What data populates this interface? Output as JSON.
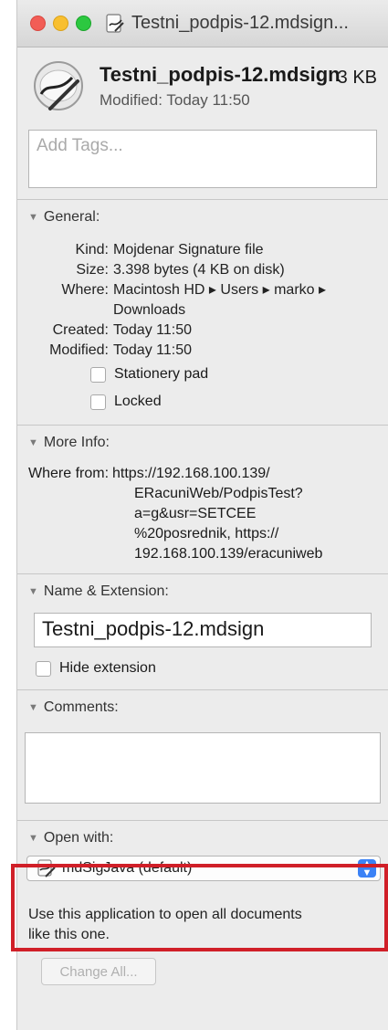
{
  "window": {
    "title": "Testni_podpis-12.mdsign..."
  },
  "header": {
    "filename": "Testni_podpis-12.mdsign",
    "size": "3 KB",
    "modified": "Modified: Today 11:50"
  },
  "tags": {
    "placeholder": "Add Tags..."
  },
  "general": {
    "heading": "General:",
    "rows": [
      {
        "key": "Kind:",
        "value": "Mojdenar Signature file"
      },
      {
        "key": "Size:",
        "value": "3.398 bytes (4 KB on disk)"
      },
      {
        "key": "Where:",
        "value": "Macintosh HD ▸ Users ▸ marko ▸",
        "value2": "Downloads"
      },
      {
        "key": "Created:",
        "value": "Today 11:50"
      },
      {
        "key": "Modified:",
        "value": "Today 11:50"
      }
    ],
    "stationery_label": "Stationery pad",
    "locked_label": "Locked"
  },
  "more_info": {
    "heading": "More Info:",
    "where_from_key": "Where from:",
    "where_from_lines": [
      "https://192.168.100.139/",
      "ERacuniWeb/PodpisTest?",
      "a=g&usr=SETCEE",
      "%20posrednik, https://",
      "192.168.100.139/eracuniweb"
    ]
  },
  "name_ext": {
    "heading": "Name & Extension:",
    "value": "Testni_podpis-12.mdsign",
    "hide_ext_label": "Hide extension"
  },
  "comments": {
    "heading": "Comments:"
  },
  "open_with": {
    "heading": "Open with:",
    "selected": "mdSigJava (default)",
    "description_line1": "Use this application to open all documents",
    "description_line2": "like this one.",
    "change_all": "Change All..."
  },
  "colors": {
    "highlight": "#d01f28",
    "popup_accent": "#3b82f6"
  }
}
